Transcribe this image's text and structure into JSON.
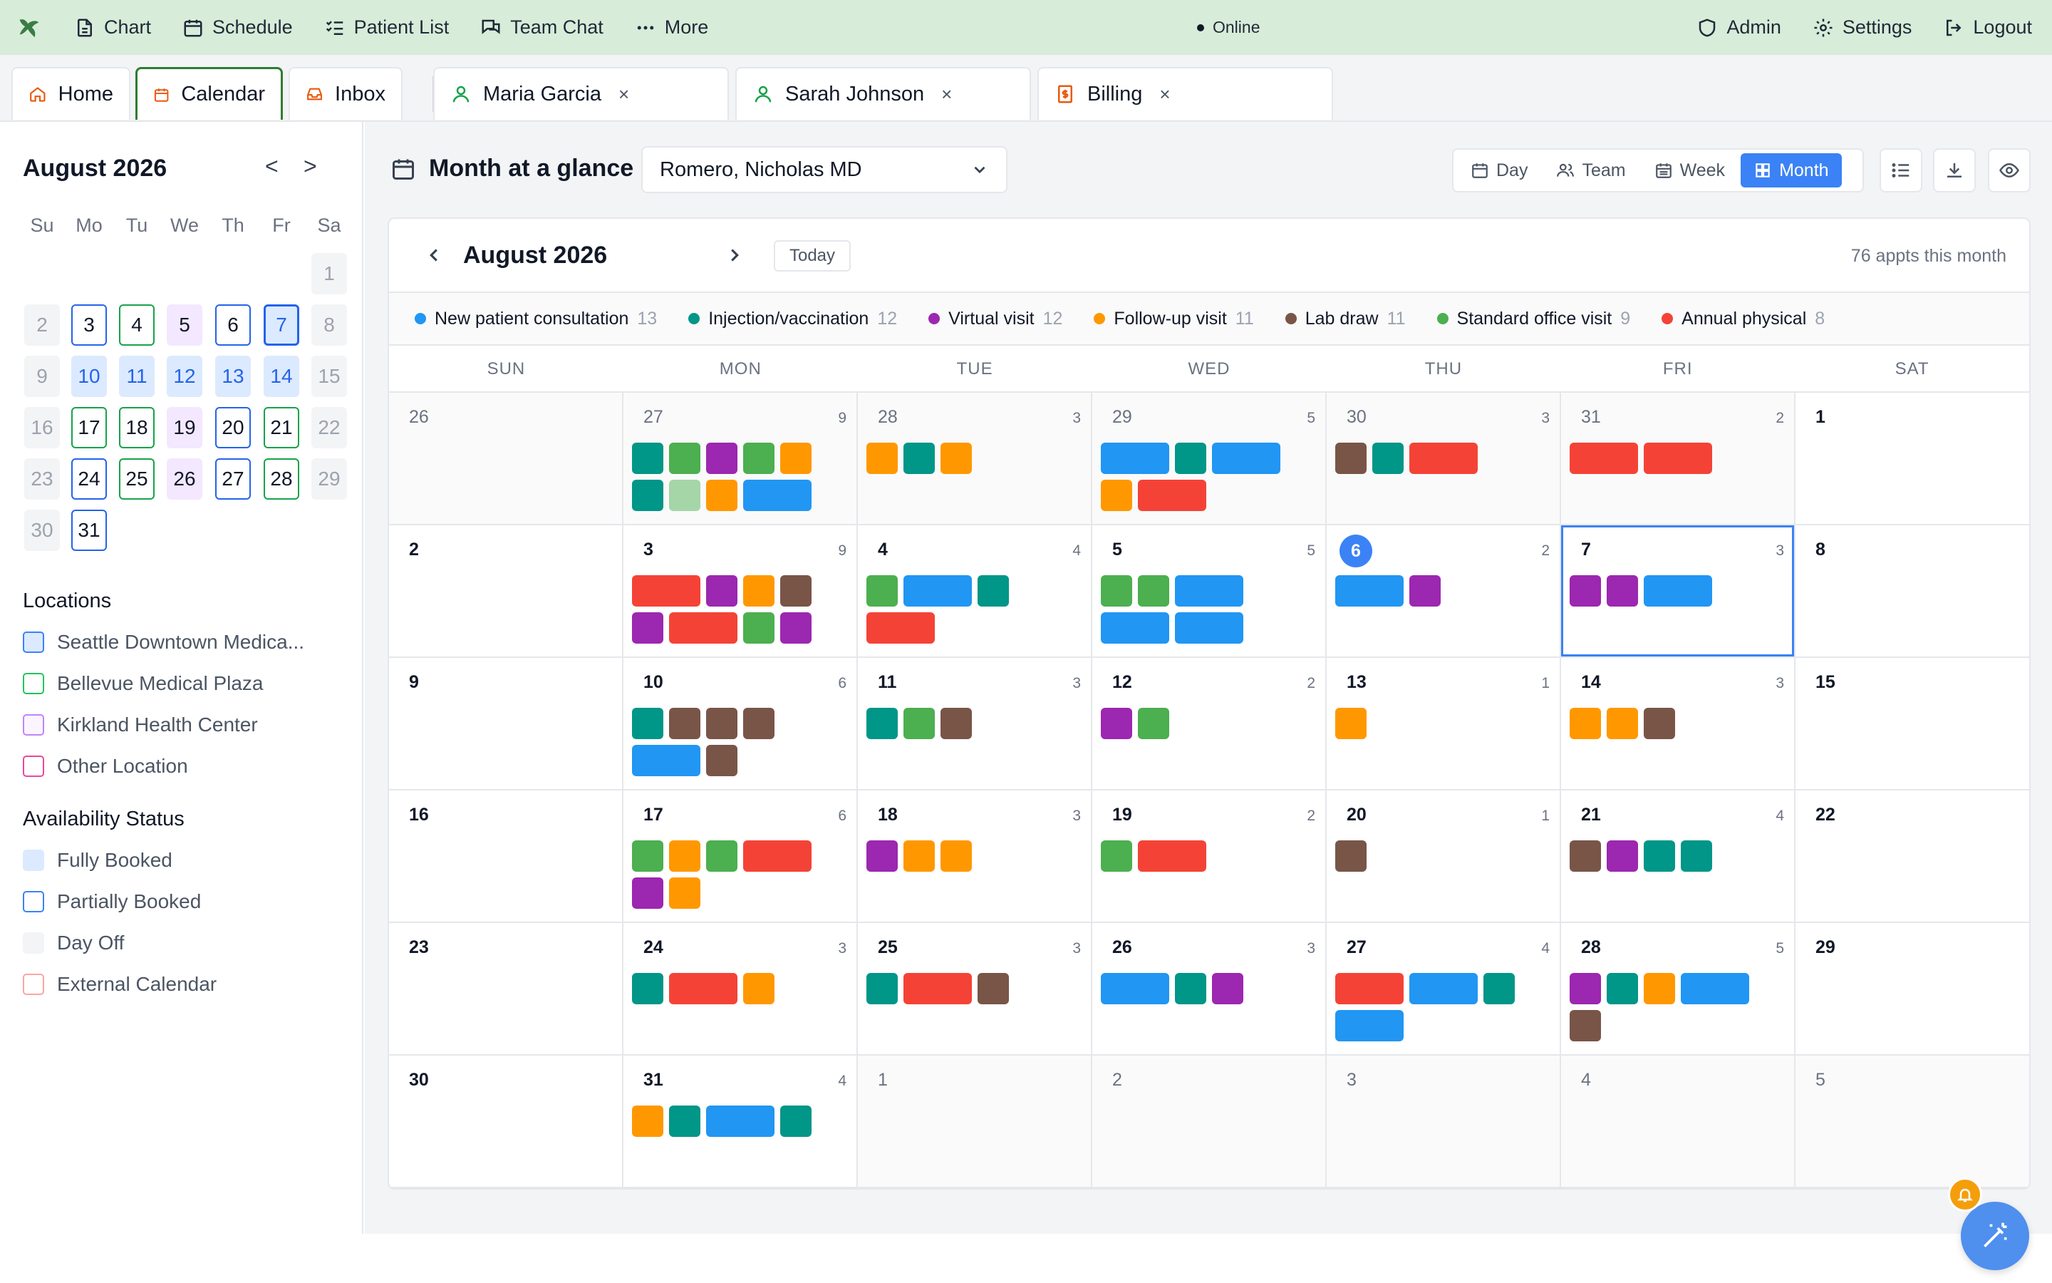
{
  "topnav": {
    "items": [
      "Chart",
      "Schedule",
      "Patient List",
      "Team Chat",
      "More"
    ],
    "status": "Online",
    "right": [
      "Admin",
      "Settings",
      "Logout"
    ]
  },
  "tabs": [
    "Home",
    "Calendar",
    "Inbox",
    "Maria Garcia",
    "Sarah Johnson",
    "Billing"
  ],
  "tab_close": "×",
  "sidebar": {
    "month": "August 2026",
    "prev": "<",
    "next": ">",
    "weekdays": [
      "Su",
      "Mo",
      "Tu",
      "We",
      "Th",
      "Fr",
      "Sa"
    ],
    "days": [
      {
        "n": "1",
        "s": "muted"
      },
      {
        "n": "2",
        "s": "muted"
      },
      {
        "n": "3",
        "s": "blue"
      },
      {
        "n": "4",
        "s": "green"
      },
      {
        "n": "5",
        "s": "purple"
      },
      {
        "n": "6",
        "s": "blue"
      },
      {
        "n": "7",
        "s": "sel"
      },
      {
        "n": "8",
        "s": "muted"
      },
      {
        "n": "9",
        "s": "muted"
      },
      {
        "n": "10",
        "s": "lblue"
      },
      {
        "n": "11",
        "s": "lblue"
      },
      {
        "n": "12",
        "s": "lblue"
      },
      {
        "n": "13",
        "s": "lblue"
      },
      {
        "n": "14",
        "s": "lblue"
      },
      {
        "n": "15",
        "s": "muted"
      },
      {
        "n": "16",
        "s": "muted"
      },
      {
        "n": "17",
        "s": "green"
      },
      {
        "n": "18",
        "s": "green"
      },
      {
        "n": "19",
        "s": "purple"
      },
      {
        "n": "20",
        "s": "blue"
      },
      {
        "n": "21",
        "s": "green"
      },
      {
        "n": "22",
        "s": "muted"
      },
      {
        "n": "23",
        "s": "muted"
      },
      {
        "n": "24",
        "s": "blue"
      },
      {
        "n": "25",
        "s": "green"
      },
      {
        "n": "26",
        "s": "purple"
      },
      {
        "n": "27",
        "s": "blue"
      },
      {
        "n": "28",
        "s": "green"
      },
      {
        "n": "29",
        "s": "muted"
      },
      {
        "n": "30",
        "s": "muted"
      },
      {
        "n": "31",
        "s": "blue"
      }
    ],
    "locations_title": "Locations",
    "locations": [
      {
        "label": "Seattle Downtown Medica...",
        "bg": "#dbeafe",
        "border": "#3b82f6"
      },
      {
        "label": "Bellevue Medical Plaza",
        "bg": "#ffffff",
        "border": "#22c55e"
      },
      {
        "label": "Kirkland Health Center",
        "bg": "#faf5ff",
        "border": "#c084fc"
      },
      {
        "label": "Other Location",
        "bg": "#ffffff",
        "border": "#ec4899"
      }
    ],
    "availability_title": "Availability Status",
    "availability": [
      {
        "label": "Fully Booked",
        "bg": "#dbeafe",
        "border": "#dbeafe"
      },
      {
        "label": "Partially Booked",
        "bg": "#ffffff",
        "border": "#3b82f6"
      },
      {
        "label": "Day Off",
        "bg": "#f3f4f6",
        "border": "#f3f4f6"
      },
      {
        "label": "External Calendar",
        "bg": "#ffffff",
        "border": "#fca5a5"
      }
    ]
  },
  "main": {
    "title": "Month at a glance",
    "provider": "Romero, Nicholas MD",
    "views": [
      "Day",
      "Team",
      "Week",
      "Month"
    ],
    "active_view": "Month",
    "calendar": {
      "title": "August 2026",
      "today": "Today",
      "appt_count": "76 appts this month",
      "dow": [
        "SUN",
        "MON",
        "TUE",
        "WED",
        "THU",
        "FRI",
        "SAT"
      ]
    }
  },
  "legend": [
    {
      "label": "New patient consultation",
      "count": "13",
      "color": "#2196f3"
    },
    {
      "label": "Injection/vaccination",
      "count": "12",
      "color": "#009688"
    },
    {
      "label": "Virtual visit",
      "count": "12",
      "color": "#9c27b0"
    },
    {
      "label": "Follow-up visit",
      "count": "11",
      "color": "#ff9800"
    },
    {
      "label": "Lab draw",
      "count": "11",
      "color": "#795548"
    },
    {
      "label": "Standard office visit",
      "count": "9",
      "color": "#4caf50"
    },
    {
      "label": "Annual physical",
      "count": "8",
      "color": "#f44336"
    }
  ],
  "colors": {
    "B": "#2196f3",
    "T": "#009688",
    "P": "#9c27b0",
    "O": "#ff9800",
    "N": "#795548",
    "G": "#4caf50",
    "R": "#f44336",
    "L": "#a5d6a7"
  },
  "weeks": [
    [
      {
        "n": "26",
        "out": true
      },
      {
        "n": "27",
        "out": true,
        "c": "9",
        "a": "T G P G O T L O B"
      },
      {
        "n": "28",
        "out": true,
        "c": "3",
        "a": "O T O"
      },
      {
        "n": "29",
        "out": true,
        "c": "5",
        "a": "B T B O R"
      },
      {
        "n": "30",
        "out": true,
        "c": "3",
        "a": "N T R"
      },
      {
        "n": "31",
        "out": true,
        "c": "2",
        "a": "R R"
      },
      {
        "n": "1"
      }
    ],
    [
      {
        "n": "2"
      },
      {
        "n": "3",
        "c": "9",
        "a": "R P O N P R G P"
      },
      {
        "n": "4",
        "c": "4",
        "a": "G B T R"
      },
      {
        "n": "5",
        "c": "5",
        "a": "G G B B B"
      },
      {
        "n": "6",
        "c": "2",
        "a": "B P",
        "today": true
      },
      {
        "n": "7",
        "c": "3",
        "a": "P P B",
        "sel": true
      },
      {
        "n": "8"
      }
    ],
    [
      {
        "n": "9"
      },
      {
        "n": "10",
        "c": "6",
        "a": "T N N N B N"
      },
      {
        "n": "11",
        "c": "3",
        "a": "T G N"
      },
      {
        "n": "12",
        "c": "2",
        "a": "P G"
      },
      {
        "n": "13",
        "c": "1",
        "a": "O"
      },
      {
        "n": "14",
        "c": "3",
        "a": "O O N"
      },
      {
        "n": "15"
      }
    ],
    [
      {
        "n": "16"
      },
      {
        "n": "17",
        "c": "6",
        "a": "G O G R P O"
      },
      {
        "n": "18",
        "c": "3",
        "a": "P O O"
      },
      {
        "n": "19",
        "c": "2",
        "a": "G R"
      },
      {
        "n": "20",
        "c": "1",
        "a": "N"
      },
      {
        "n": "21",
        "c": "4",
        "a": "N P T T"
      },
      {
        "n": "22"
      }
    ],
    [
      {
        "n": "23"
      },
      {
        "n": "24",
        "c": "3",
        "a": "T R O"
      },
      {
        "n": "25",
        "c": "3",
        "a": "T R N"
      },
      {
        "n": "26",
        "c": "3",
        "a": "B T P"
      },
      {
        "n": "27",
        "c": "4",
        "a": "R B T B"
      },
      {
        "n": "28",
        "c": "5",
        "a": "P T O B N"
      },
      {
        "n": "29"
      }
    ],
    [
      {
        "n": "30"
      },
      {
        "n": "31",
        "c": "4",
        "a": "O T B T"
      },
      {
        "n": "1",
        "out": true
      },
      {
        "n": "2",
        "out": true
      },
      {
        "n": "3",
        "out": true
      },
      {
        "n": "4",
        "out": true
      },
      {
        "n": "5",
        "out": true
      }
    ]
  ]
}
